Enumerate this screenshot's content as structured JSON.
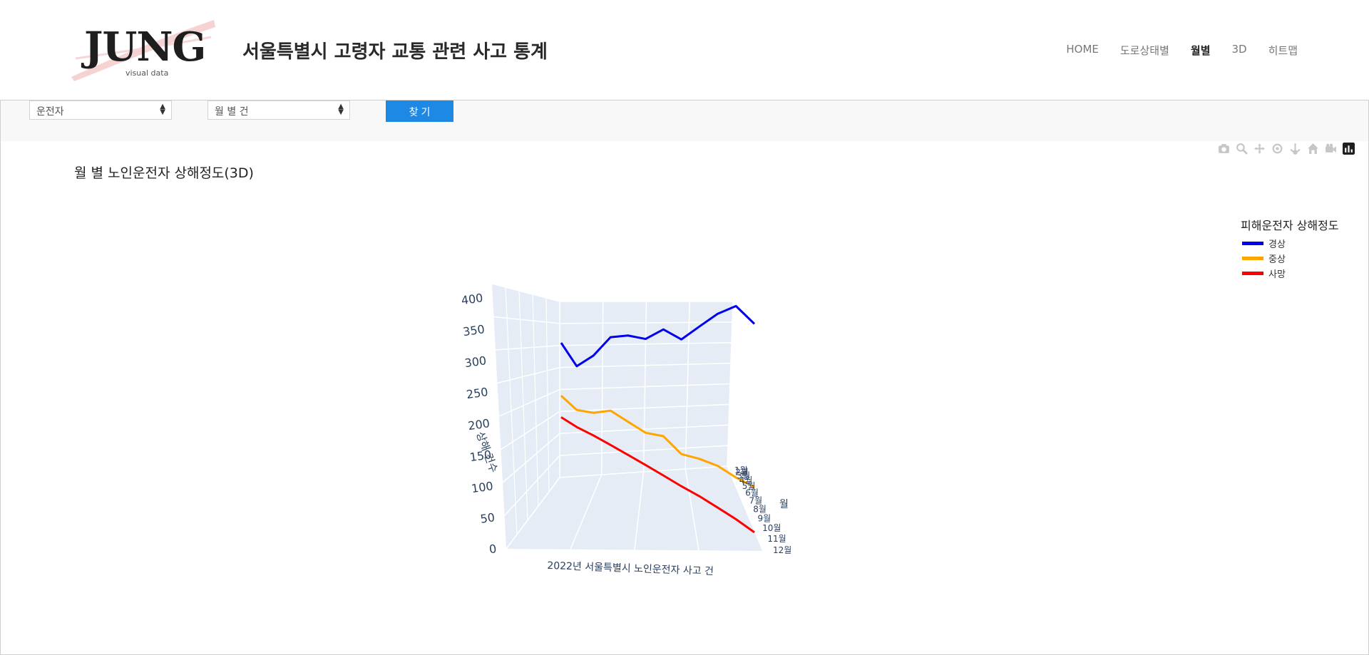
{
  "header": {
    "logo_text": "JUNG",
    "logo_subtitle": "visual data",
    "site_title": "서울특별시 고령자 교통 관련 사고 통계",
    "nav": [
      {
        "label": "HOME",
        "active": false
      },
      {
        "label": "도로상태별",
        "active": false
      },
      {
        "label": "월별",
        "active": true
      },
      {
        "label": "3D",
        "active": false
      },
      {
        "label": "히트맵",
        "active": false
      }
    ]
  },
  "controls": {
    "target_select": "운전자",
    "unit_select": "월 별 건",
    "search_label": "찾 기"
  },
  "modebar_icons": [
    "camera-icon",
    "zoom-icon",
    "pan-icon",
    "orbit-icon",
    "turntable-icon",
    "home-icon",
    "video-camera-icon",
    "plotly-logo-icon"
  ],
  "chart_data": {
    "type": "line",
    "title": "월 별 노인운전자 상해정도(3D)",
    "xlabel": "2022년 서울특별시 노인운전자 사고 건",
    "ylabel": "월",
    "zlabel": "상해 건수",
    "y_categories": [
      "1월",
      "2월",
      "3월",
      "4월",
      "5월",
      "6월",
      "7월",
      "8월",
      "9월",
      "10월",
      "11월",
      "12월"
    ],
    "zlim": [
      0,
      400
    ],
    "z_ticks": [
      "0",
      "50",
      "100",
      "150",
      "200",
      "250",
      "300",
      "350",
      "400"
    ],
    "legend_title": "피해운전자 상해정도",
    "legend_position": "top-right",
    "series": [
      {
        "name": "경상",
        "color": "#0000ee",
        "values": [
          300,
          250,
          280,
          325,
          332,
          328,
          350,
          333,
          360,
          385,
          400,
          370
        ]
      },
      {
        "name": "중상",
        "color": "#ffa500",
        "values": [
          172,
          148,
          151,
          165,
          150,
          136,
          138,
          112,
          112,
          108,
          96,
          88
        ]
      },
      {
        "name": "사망",
        "color": "#ff0000",
        "values": [
          120,
          108,
          100,
          90,
          80,
          70,
          60,
          50,
          42,
          32,
          22,
          10
        ]
      }
    ]
  }
}
